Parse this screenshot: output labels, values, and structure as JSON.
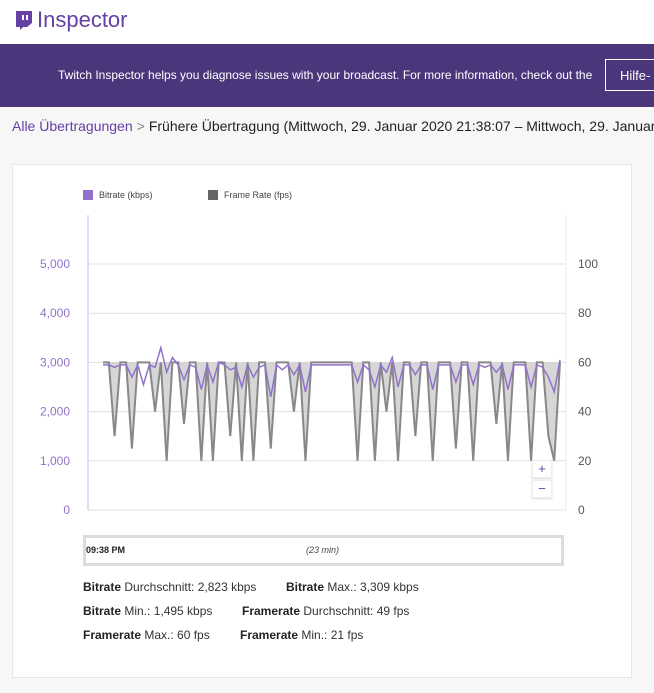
{
  "header": {
    "logo_text": "Inspector"
  },
  "banner": {
    "message": "Twitch Inspector helps you diagnose issues with your broadcast. For more information, check out the",
    "help_button": "Hilfe-"
  },
  "breadcrumb": {
    "root": "Alle Übertragungen",
    "separator": ">",
    "current": "Frühere Übertragung (Mittwoch, 29. Januar 2020 21:38:07 – Mittwoch, 29. Januar"
  },
  "chart_data": {
    "type": "line",
    "legend": [
      {
        "name": "Bitrate (kbps)",
        "color": "#9271cc"
      },
      {
        "name": "Frame Rate (fps)",
        "color": "#666666"
      }
    ],
    "left_axis": {
      "ticks": [
        "0",
        "1,000",
        "2,000",
        "3,000",
        "4,000",
        "5,000"
      ],
      "range": [
        0,
        5000
      ]
    },
    "right_axis": {
      "ticks": [
        "0",
        "20",
        "40",
        "60",
        "80",
        "100"
      ],
      "range": [
        0,
        100
      ]
    },
    "series": [
      {
        "name": "Bitrate (kbps)",
        "values": [
          2950,
          2950,
          2900,
          2950,
          2950,
          2700,
          2950,
          2550,
          2950,
          2900,
          3300,
          2800,
          3100,
          2950,
          2650,
          2950,
          2900,
          2450,
          2950,
          2600,
          3000,
          2950,
          2850,
          2900,
          2500,
          2950,
          2700,
          2900,
          2950,
          2300,
          2950,
          2850,
          2950,
          2750,
          2950,
          2400,
          2950,
          2950,
          2950,
          2950,
          2950,
          2950,
          2950,
          2950,
          2600,
          2950,
          2850,
          2500,
          2950,
          2800,
          3100,
          2500,
          2950,
          2950,
          2750,
          2950,
          2950,
          2450,
          2950,
          2950,
          2950,
          2600,
          2950,
          2950,
          2550,
          2950,
          2900,
          2950,
          2800,
          2950,
          2450,
          2950,
          2950,
          2950,
          2500,
          2950,
          2900,
          2700,
          2400,
          3050
        ]
      },
      {
        "name": "Frame Rate (fps)",
        "values": [
          60,
          60,
          30,
          60,
          60,
          25,
          60,
          60,
          60,
          40,
          60,
          20,
          60,
          60,
          35,
          60,
          60,
          20,
          60,
          20,
          60,
          60,
          30,
          60,
          20,
          60,
          20,
          60,
          60,
          25,
          60,
          60,
          60,
          40,
          60,
          20,
          60,
          60,
          60,
          60,
          60,
          60,
          60,
          60,
          20,
          60,
          60,
          20,
          60,
          40,
          60,
          20,
          60,
          60,
          30,
          60,
          60,
          20,
          60,
          60,
          60,
          25,
          60,
          60,
          20,
          60,
          60,
          60,
          35,
          60,
          20,
          60,
          60,
          60,
          20,
          60,
          60,
          30,
          20,
          60
        ]
      }
    ]
  },
  "timeline": {
    "start": "09:38 PM",
    "duration": "(23 min)"
  },
  "zoom": {
    "in": "+",
    "out": "−"
  },
  "stats": [
    {
      "label": "Bitrate",
      "text": " Durchschnitt: 2,823 kbps"
    },
    {
      "label": "Bitrate",
      "text": " Max.: 3,309 kbps"
    },
    {
      "label": "Bitrate",
      "text": " Min.: 1,495 kbps"
    },
    {
      "label": "Framerate",
      "text": " Durchschnitt: 49 fps"
    },
    {
      "label": "Framerate",
      "text": " Max.: 60 fps"
    },
    {
      "label": "Framerate",
      "text": " Min.: 21 fps"
    }
  ]
}
